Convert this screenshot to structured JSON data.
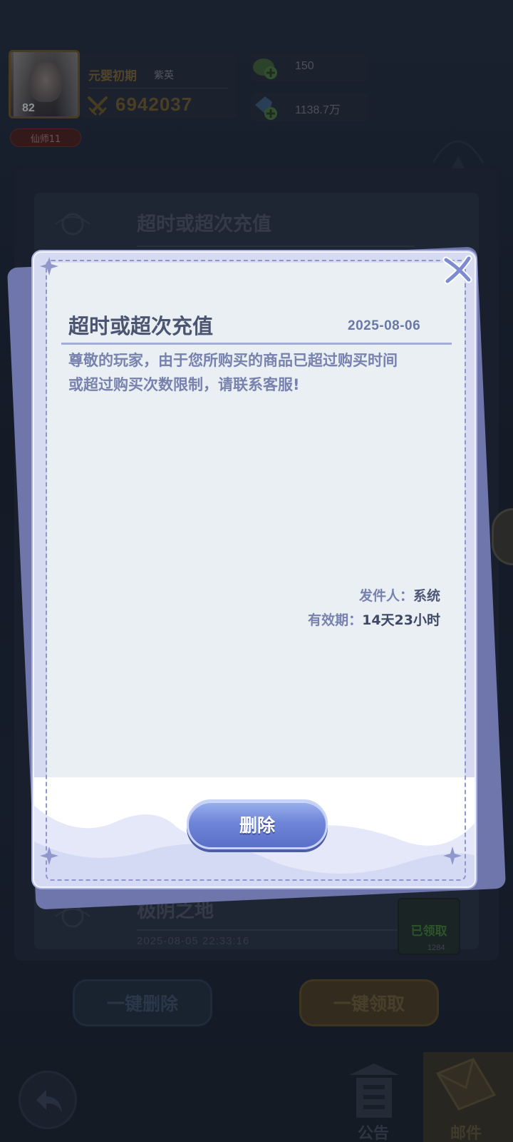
{
  "player": {
    "level": "82",
    "rank_badge": "仙师11",
    "realm": "元婴初期",
    "name": "紫英",
    "power": "6942037"
  },
  "resources": [
    {
      "icon": "spirit-stone-plus-icon",
      "value": "150"
    },
    {
      "icon": "gem-plus-icon",
      "value": "1138.7万"
    }
  ],
  "mail_list": {
    "items": [
      {
        "title": "超时或超次充值"
      },
      {
        "title": "极阴之地",
        "date": "2025-08-05 22:33:16",
        "status": "已领取",
        "count": "1284"
      }
    ]
  },
  "actions": {
    "delete_all": "一键删除",
    "claim_all": "一键领取"
  },
  "nav": {
    "notice_label": "公告",
    "mail_label": "邮件"
  },
  "modal": {
    "title": "超时或超次充值",
    "date": "2025-08-06",
    "body_line1": "尊敬的玩家，由于您所购买的商品已超过购买时间",
    "body_line2": "或超过购买次数限制，请联系客服!",
    "sender_label": "发件人：",
    "sender_value": "系统",
    "expiry_label": "有效期：",
    "expiry_value": "14天23小时",
    "delete_button": "删除"
  },
  "colors": {
    "modal_bg": "#eaeff4",
    "modal_border": "#a9b2e0",
    "accent_blue": "#6f86d8",
    "title_text": "#4b5572"
  }
}
